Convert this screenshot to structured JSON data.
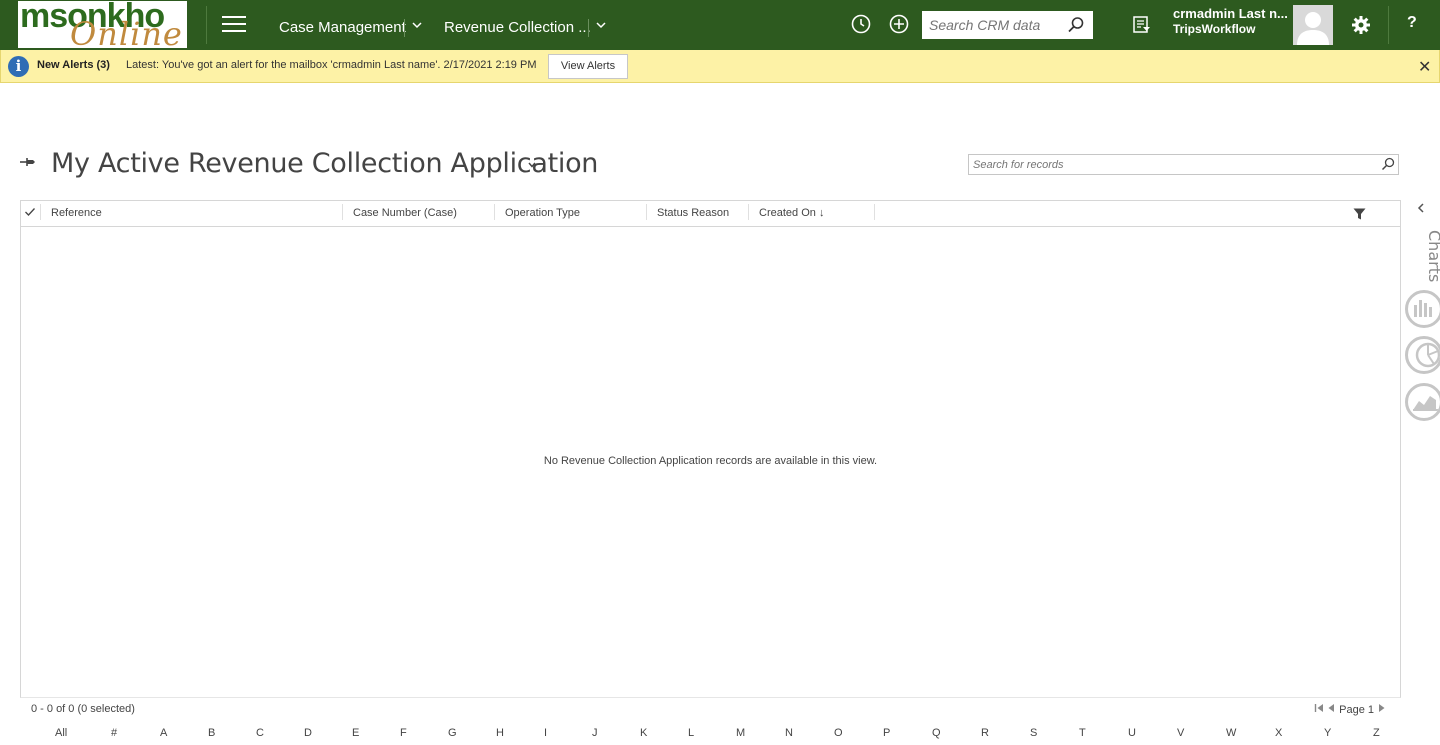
{
  "logo": {
    "line1": "msonkho",
    "line2": "Online"
  },
  "header": {
    "nav": [
      {
        "label": "Case Management"
      },
      {
        "label": "Revenue Collection ..."
      }
    ],
    "search": {
      "placeholder": "Search CRM data"
    },
    "user": {
      "name": "crmadmin Last n...",
      "org": "TripsWorkflow"
    },
    "help_label": "?"
  },
  "alert": {
    "title": "New Alerts (3)",
    "message": "Latest: You've got an alert for the mailbox 'crmadmin Last name'. 2/17/2021 2:19 PM",
    "button": "View Alerts",
    "close": "✕"
  },
  "view": {
    "title": "My Active Revenue Collection Application",
    "search_placeholder": "Search for records"
  },
  "grid": {
    "columns": [
      "Reference",
      "Case Number (Case)",
      "Operation Type",
      "Status Reason",
      "Created On"
    ],
    "sorted_column_indicator": "↓",
    "empty_message": "No Revenue Collection Application records are available in this view.",
    "footer_count": "0 - 0 of 0 (0 selected)",
    "page_label": "Page 1"
  },
  "alphabet": [
    "All",
    "#",
    "A",
    "B",
    "C",
    "D",
    "E",
    "F",
    "G",
    "H",
    "I",
    "J",
    "K",
    "L",
    "M",
    "N",
    "O",
    "P",
    "Q",
    "R",
    "S",
    "T",
    "U",
    "V",
    "W",
    "X",
    "Y",
    "Z"
  ],
  "charts_panel": {
    "label": "Charts"
  }
}
